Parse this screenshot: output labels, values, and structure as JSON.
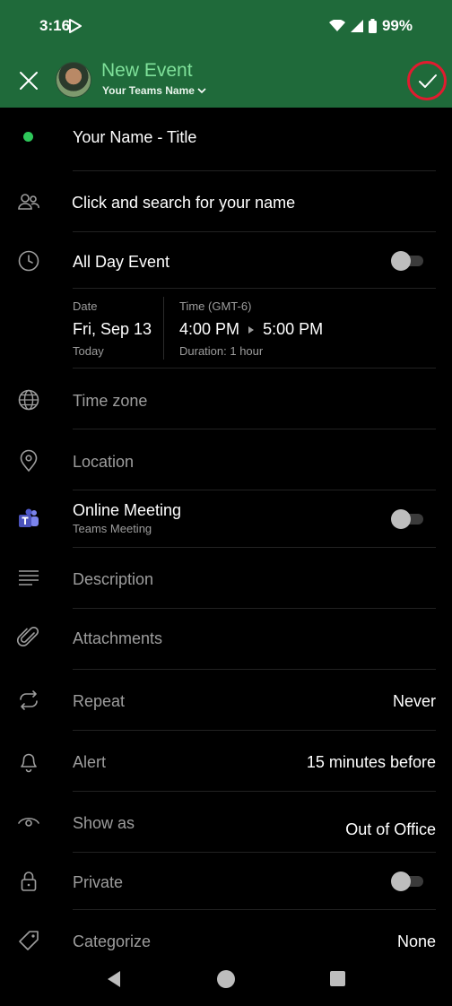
{
  "status": {
    "time": "3:16",
    "battery": "99%"
  },
  "appbar": {
    "title": "New Event",
    "team_name": "Your Teams Name"
  },
  "event": {
    "title": "Your Name - Title",
    "attendees_placeholder": "Click and search for your name",
    "all_day_label": "All Day Event",
    "all_day_on": false,
    "date_label": "Date",
    "date_value": "Fri, Sep 13",
    "date_sub": "Today",
    "time_label": "Time (GMT-6)",
    "start_time": "4:00 PM",
    "end_time": "5:00 PM",
    "duration": "Duration: 1 hour",
    "time_zone_label": "Time zone",
    "location_label": "Location",
    "online_meeting_label": "Online Meeting",
    "online_meeting_sub": "Teams Meeting",
    "online_meeting_on": false,
    "description_label": "Description",
    "attachments_label": "Attachments",
    "repeat_label": "Repeat",
    "repeat_value": "Never",
    "alert_label": "Alert",
    "alert_value": "15 minutes before",
    "show_as_label": "Show as",
    "show_as_value": "Out of Office",
    "private_label": "Private",
    "private_on": false,
    "categorize_label": "Categorize",
    "categorize_value": "None"
  },
  "colors": {
    "header_bg": "#1f6a3a",
    "title_green": "#7fe19a",
    "highlight_circle": "#e11b2f",
    "status_dot": "#2ec75a"
  },
  "icons": [
    "close-icon",
    "check-icon",
    "people-icon",
    "clock-icon",
    "globe-icon",
    "location-pin-icon",
    "teams-icon",
    "description-lines-icon",
    "paperclip-icon",
    "repeat-icon",
    "bell-icon",
    "eye-icon",
    "lock-icon",
    "tag-icon"
  ]
}
